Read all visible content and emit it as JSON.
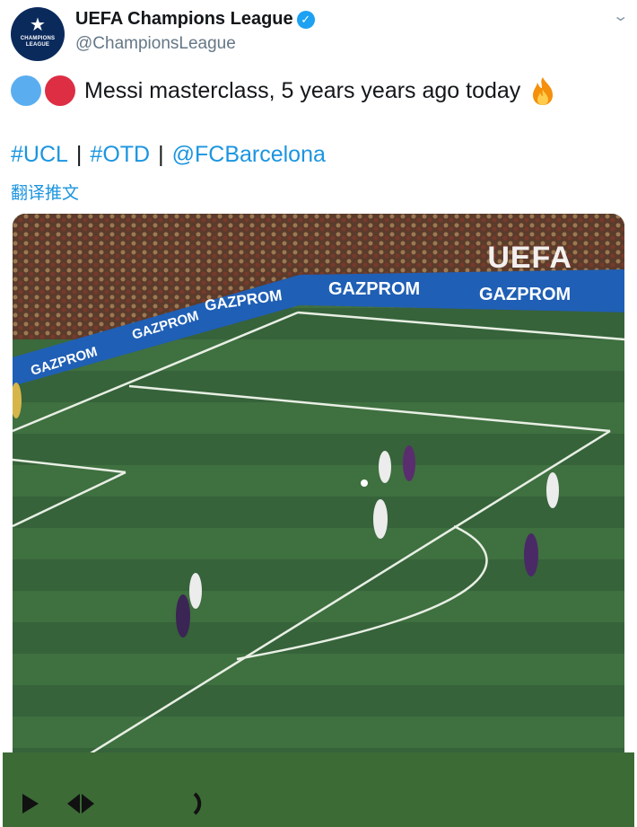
{
  "account": {
    "display_name": "UEFA Champions League",
    "handle": "@ChampionsLeague",
    "avatar_text": "CHAMPIONS LEAGUE",
    "verified_symbol": "✓"
  },
  "tweet": {
    "text": "Messi masterclass, 5 years years ago today",
    "emojis": [
      "blue-circle",
      "red-circle",
      "fire"
    ],
    "links": [
      {
        "label": "#UCL"
      },
      {
        "label": "#OTD"
      },
      {
        "label": "@FCBarcelona"
      }
    ],
    "separator": "|",
    "translate_label": "翻译推文"
  },
  "video": {
    "watermark": "UEFA",
    "ad_boards": [
      "GAZPROM",
      "GAZPROM",
      "GAZPROM",
      "GAZPROM",
      "GAZPROM"
    ]
  },
  "colors": {
    "link": "#1b95e0",
    "pitch": "#3b6a3c",
    "verified": "#1da1f2"
  }
}
